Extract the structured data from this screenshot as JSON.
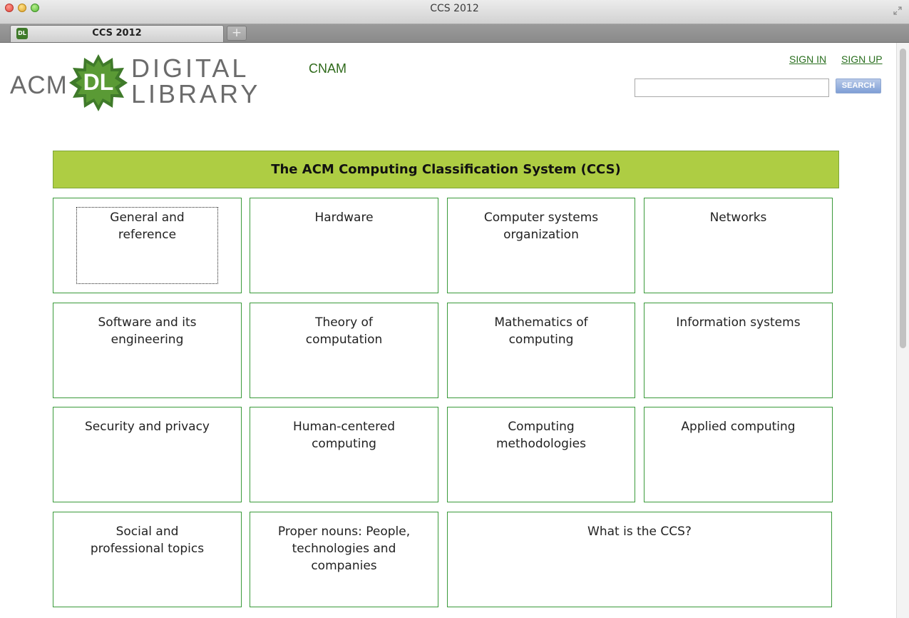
{
  "window": {
    "title": "CCS 2012",
    "tab_label": "CCS 2012",
    "tab_favicon": "DL",
    "new_tab": "+"
  },
  "header": {
    "logo": {
      "acm": "ACM",
      "badge": "DL",
      "digital": "DIGITAL",
      "library": "LIBRARY"
    },
    "institution": "CNAM",
    "sign_in": "SIGN IN",
    "sign_up": "SIGN UP",
    "search": {
      "value": "",
      "button": "SEARCH"
    }
  },
  "banner": "The ACM Computing Classification System (CCS)",
  "categories": [
    "General and reference",
    "Hardware",
    "Computer systems organization",
    "Networks",
    "Software and its engineering",
    "Theory of computation",
    "Mathematics of computing",
    "Information systems",
    "Security and privacy",
    "Human-centered computing",
    "Computing methodologies",
    "Applied computing",
    "Social and professional topics",
    "Proper nouns: People, technologies and companies",
    "What is the CCS?"
  ],
  "colors": {
    "banner": "#aecd43",
    "cell_border": "#3a9a3a",
    "link": "#2a6f1f",
    "logo_green": "#3f7a2a"
  },
  "icons": [
    "fullscreen-icon",
    "dl-badge-icon",
    "new-tab-icon"
  ]
}
